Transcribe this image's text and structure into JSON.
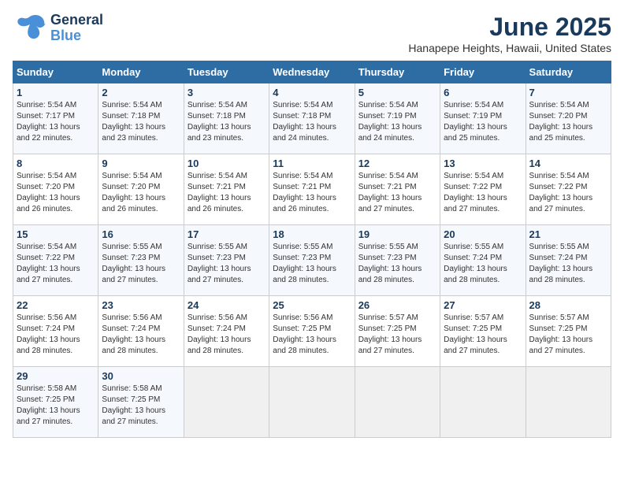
{
  "logo": {
    "general": "General",
    "blue": "Blue"
  },
  "header": {
    "title": "June 2025",
    "subtitle": "Hanapepe Heights, Hawaii, United States"
  },
  "weekdays": [
    "Sunday",
    "Monday",
    "Tuesday",
    "Wednesday",
    "Thursday",
    "Friday",
    "Saturday"
  ],
  "weeks": [
    [
      {
        "day": "1",
        "sunrise": "Sunrise: 5:54 AM",
        "sunset": "Sunset: 7:17 PM",
        "daylight": "Daylight: 13 hours and 22 minutes."
      },
      {
        "day": "2",
        "sunrise": "Sunrise: 5:54 AM",
        "sunset": "Sunset: 7:18 PM",
        "daylight": "Daylight: 13 hours and 23 minutes."
      },
      {
        "day": "3",
        "sunrise": "Sunrise: 5:54 AM",
        "sunset": "Sunset: 7:18 PM",
        "daylight": "Daylight: 13 hours and 23 minutes."
      },
      {
        "day": "4",
        "sunrise": "Sunrise: 5:54 AM",
        "sunset": "Sunset: 7:18 PM",
        "daylight": "Daylight: 13 hours and 24 minutes."
      },
      {
        "day": "5",
        "sunrise": "Sunrise: 5:54 AM",
        "sunset": "Sunset: 7:19 PM",
        "daylight": "Daylight: 13 hours and 24 minutes."
      },
      {
        "day": "6",
        "sunrise": "Sunrise: 5:54 AM",
        "sunset": "Sunset: 7:19 PM",
        "daylight": "Daylight: 13 hours and 25 minutes."
      },
      {
        "day": "7",
        "sunrise": "Sunrise: 5:54 AM",
        "sunset": "Sunset: 7:20 PM",
        "daylight": "Daylight: 13 hours and 25 minutes."
      }
    ],
    [
      {
        "day": "8",
        "sunrise": "Sunrise: 5:54 AM",
        "sunset": "Sunset: 7:20 PM",
        "daylight": "Daylight: 13 hours and 26 minutes."
      },
      {
        "day": "9",
        "sunrise": "Sunrise: 5:54 AM",
        "sunset": "Sunset: 7:20 PM",
        "daylight": "Daylight: 13 hours and 26 minutes."
      },
      {
        "day": "10",
        "sunrise": "Sunrise: 5:54 AM",
        "sunset": "Sunset: 7:21 PM",
        "daylight": "Daylight: 13 hours and 26 minutes."
      },
      {
        "day": "11",
        "sunrise": "Sunrise: 5:54 AM",
        "sunset": "Sunset: 7:21 PM",
        "daylight": "Daylight: 13 hours and 26 minutes."
      },
      {
        "day": "12",
        "sunrise": "Sunrise: 5:54 AM",
        "sunset": "Sunset: 7:21 PM",
        "daylight": "Daylight: 13 hours and 27 minutes."
      },
      {
        "day": "13",
        "sunrise": "Sunrise: 5:54 AM",
        "sunset": "Sunset: 7:22 PM",
        "daylight": "Daylight: 13 hours and 27 minutes."
      },
      {
        "day": "14",
        "sunrise": "Sunrise: 5:54 AM",
        "sunset": "Sunset: 7:22 PM",
        "daylight": "Daylight: 13 hours and 27 minutes."
      }
    ],
    [
      {
        "day": "15",
        "sunrise": "Sunrise: 5:54 AM",
        "sunset": "Sunset: 7:22 PM",
        "daylight": "Daylight: 13 hours and 27 minutes."
      },
      {
        "day": "16",
        "sunrise": "Sunrise: 5:55 AM",
        "sunset": "Sunset: 7:23 PM",
        "daylight": "Daylight: 13 hours and 27 minutes."
      },
      {
        "day": "17",
        "sunrise": "Sunrise: 5:55 AM",
        "sunset": "Sunset: 7:23 PM",
        "daylight": "Daylight: 13 hours and 27 minutes."
      },
      {
        "day": "18",
        "sunrise": "Sunrise: 5:55 AM",
        "sunset": "Sunset: 7:23 PM",
        "daylight": "Daylight: 13 hours and 28 minutes."
      },
      {
        "day": "19",
        "sunrise": "Sunrise: 5:55 AM",
        "sunset": "Sunset: 7:23 PM",
        "daylight": "Daylight: 13 hours and 28 minutes."
      },
      {
        "day": "20",
        "sunrise": "Sunrise: 5:55 AM",
        "sunset": "Sunset: 7:24 PM",
        "daylight": "Daylight: 13 hours and 28 minutes."
      },
      {
        "day": "21",
        "sunrise": "Sunrise: 5:55 AM",
        "sunset": "Sunset: 7:24 PM",
        "daylight": "Daylight: 13 hours and 28 minutes."
      }
    ],
    [
      {
        "day": "22",
        "sunrise": "Sunrise: 5:56 AM",
        "sunset": "Sunset: 7:24 PM",
        "daylight": "Daylight: 13 hours and 28 minutes."
      },
      {
        "day": "23",
        "sunrise": "Sunrise: 5:56 AM",
        "sunset": "Sunset: 7:24 PM",
        "daylight": "Daylight: 13 hours and 28 minutes."
      },
      {
        "day": "24",
        "sunrise": "Sunrise: 5:56 AM",
        "sunset": "Sunset: 7:24 PM",
        "daylight": "Daylight: 13 hours and 28 minutes."
      },
      {
        "day": "25",
        "sunrise": "Sunrise: 5:56 AM",
        "sunset": "Sunset: 7:25 PM",
        "daylight": "Daylight: 13 hours and 28 minutes."
      },
      {
        "day": "26",
        "sunrise": "Sunrise: 5:57 AM",
        "sunset": "Sunset: 7:25 PM",
        "daylight": "Daylight: 13 hours and 27 minutes."
      },
      {
        "day": "27",
        "sunrise": "Sunrise: 5:57 AM",
        "sunset": "Sunset: 7:25 PM",
        "daylight": "Daylight: 13 hours and 27 minutes."
      },
      {
        "day": "28",
        "sunrise": "Sunrise: 5:57 AM",
        "sunset": "Sunset: 7:25 PM",
        "daylight": "Daylight: 13 hours and 27 minutes."
      }
    ],
    [
      {
        "day": "29",
        "sunrise": "Sunrise: 5:58 AM",
        "sunset": "Sunset: 7:25 PM",
        "daylight": "Daylight: 13 hours and 27 minutes."
      },
      {
        "day": "30",
        "sunrise": "Sunrise: 5:58 AM",
        "sunset": "Sunset: 7:25 PM",
        "daylight": "Daylight: 13 hours and 27 minutes."
      },
      null,
      null,
      null,
      null,
      null
    ]
  ]
}
